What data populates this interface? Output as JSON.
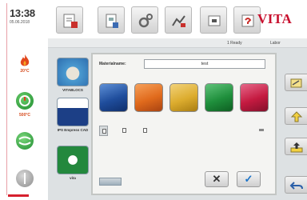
{
  "status": {
    "time": "13:38",
    "date": "05.06.2018",
    "furnace_temp": "20°C",
    "set_temp": "500°C"
  },
  "toolbar": {
    "brand": "VITA",
    "buttons": [
      "programs-icon",
      "material-icon",
      "settings-icon",
      "statistics-icon",
      "info-icon",
      "help-icon"
    ]
  },
  "infoline": {
    "ready": "1 Ready",
    "labor": "Labor"
  },
  "materials": [
    {
      "label": "VITABLOCS",
      "color": "#4a9ad0"
    },
    {
      "label": "IPS Empress CAD",
      "color": "#1c3f86"
    },
    {
      "label": "vita",
      "color": "#23883d"
    }
  ],
  "dialog": {
    "field_label": "Materialname:",
    "field_value": "test",
    "swatches": [
      {
        "name": "blue",
        "color": "#1f4d9c"
      },
      {
        "name": "orange",
        "color": "#e06a1c"
      },
      {
        "name": "gold",
        "color": "#dcac2e"
      },
      {
        "name": "green",
        "color": "#1f8f3c"
      },
      {
        "name": "crimson",
        "color": "#c41a40"
      }
    ],
    "cancel_symbol": "✕",
    "ok_symbol": "✓"
  },
  "colors": {
    "accent_red": "#c8102e",
    "background": "#dde1e3"
  }
}
